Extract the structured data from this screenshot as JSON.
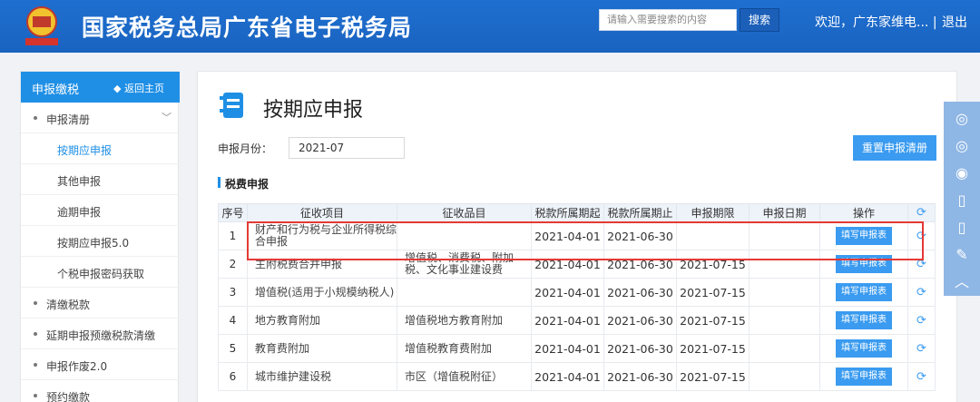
{
  "header": {
    "site_title": "国家税务总局广东省电子税务局",
    "search_placeholder": "请输入需要搜索的内容",
    "search_button": "搜索",
    "welcome": "欢迎，广东家维电...",
    "separator": "|",
    "logout": "退出"
  },
  "sidebar": {
    "title": "申报缴税",
    "back": "返回主页",
    "items": [
      {
        "label": "申报清册",
        "type": "group"
      },
      {
        "label": "按期应申报",
        "type": "sub",
        "active": true
      },
      {
        "label": "其他申报",
        "type": "sub"
      },
      {
        "label": "逾期申报",
        "type": "sub"
      },
      {
        "label": "按期应申报5.0",
        "type": "sub"
      },
      {
        "label": "个税申报密码获取",
        "type": "sub"
      },
      {
        "label": "清缴税款",
        "type": "group"
      },
      {
        "label": "延期申报预缴税款清缴",
        "type": "group"
      },
      {
        "label": "申报作废2.0",
        "type": "group"
      },
      {
        "label": "预约缴款",
        "type": "group"
      }
    ]
  },
  "main": {
    "page_title": "按期应申报",
    "period_label": "申报月份：",
    "period_value": "2021-07",
    "reset_button": "重置申报清册",
    "section_title": "税费申报",
    "table": {
      "headers": [
        "序号",
        "征收项目",
        "征收品目",
        "税款所属期起",
        "税款所属期止",
        "申报期限",
        "申报日期",
        "操作"
      ],
      "action_label": "填写申报表",
      "rows": [
        {
          "no": "1",
          "item": "财产和行为税与企业所得税综合申报",
          "sub": "",
          "start": "2021-04-01",
          "end": "2021-06-30",
          "deadline": "",
          "date": ""
        },
        {
          "no": "2",
          "item": "主附税费合并申报",
          "sub": "增值税、消费税、附加税、文化事业建设费",
          "start": "2021-04-01",
          "end": "2021-06-30",
          "deadline": "2021-07-15",
          "date": ""
        },
        {
          "no": "3",
          "item": "增值税(适用于小规模纳税人)",
          "sub": "",
          "start": "2021-04-01",
          "end": "2021-06-30",
          "deadline": "2021-07-15",
          "date": ""
        },
        {
          "no": "4",
          "item": "地方教育附加",
          "sub": "增值税地方教育附加",
          "start": "2021-04-01",
          "end": "2021-06-30",
          "deadline": "2021-07-15",
          "date": ""
        },
        {
          "no": "5",
          "item": "教育费附加",
          "sub": "增值税教育费附加",
          "start": "2021-04-01",
          "end": "2021-06-30",
          "deadline": "2021-07-15",
          "date": ""
        },
        {
          "no": "6",
          "item": "城市维护建设税",
          "sub": "市区（增值税附征）",
          "start": "2021-04-01",
          "end": "2021-06-30",
          "deadline": "2021-07-15",
          "date": ""
        }
      ]
    }
  },
  "colors": {
    "header_blue": "#1a63c0",
    "accent": "#1f8fe5",
    "button": "#3a9bf0",
    "highlight": "#e53935"
  },
  "float_icons": [
    "wechat-icon",
    "wechat-alt-icon",
    "weibo-icon",
    "mobile-icon",
    "tablet-icon",
    "edit-icon",
    "back-to-top-icon"
  ]
}
